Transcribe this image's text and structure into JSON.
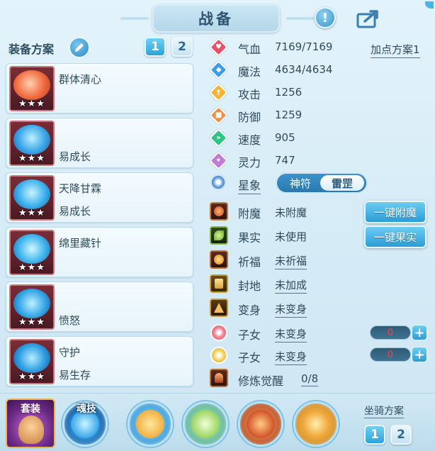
{
  "header": {
    "title": "战备",
    "info_icon": "exclamation-icon",
    "share_icon": "share-icon"
  },
  "equip_scheme": {
    "label": "装备方案",
    "edit_icon": "pencil-icon",
    "slots": [
      "1",
      "2"
    ],
    "selected_slot": "1"
  },
  "items": [
    {
      "name": "群体清心",
      "sub": "",
      "stars": "★★★",
      "icon": "scroll-icon"
    },
    {
      "name": "",
      "sub": "易成长",
      "stars": "★★★",
      "icon": "crown-icon"
    },
    {
      "name": "天降甘霖",
      "sub": "易成长",
      "stars": "★★★",
      "icon": "armor-icon"
    },
    {
      "name": "绵里藏针",
      "sub": "",
      "stars": "★★★",
      "icon": "necklace-icon"
    },
    {
      "name": "",
      "sub": "愤怒",
      "stars": "★★★",
      "icon": "belt-icon"
    },
    {
      "name": "守护",
      "sub": "易生存",
      "stars": "★★★",
      "icon": "boots-icon"
    }
  ],
  "stats": [
    {
      "name": "气血",
      "value": "7169/7169",
      "icon": "heart-icon",
      "color": "#e9506a"
    },
    {
      "name": "魔法",
      "value": "4634/4634",
      "icon": "mana-icon",
      "color": "#3a9fe6"
    },
    {
      "name": "攻击",
      "value": "1256",
      "icon": "sword-icon",
      "color": "#f2b632"
    },
    {
      "name": "防御",
      "value": "1259",
      "icon": "shield-icon",
      "color": "#f0904a"
    },
    {
      "name": "速度",
      "value": "905",
      "icon": "speed-icon",
      "color": "#2fc486"
    },
    {
      "name": "灵力",
      "value": "747",
      "icon": "spirit-icon",
      "color": "#c47ad8"
    }
  ],
  "add_point_plan": "加点方案1",
  "star_sign": {
    "label": "星象",
    "options": [
      "神符",
      "雷罡"
    ],
    "selected": "雷罡",
    "icon": "star-compass-icon"
  },
  "buffs": [
    {
      "name": "附魔",
      "value": "未附魔",
      "icon": "enchant-icon"
    },
    {
      "name": "果实",
      "value": "未使用",
      "icon": "fruit-icon"
    },
    {
      "name": "祈福",
      "value": "未祈福",
      "icon": "blessing-icon"
    },
    {
      "name": "封地",
      "value": "未加成",
      "icon": "fief-icon"
    },
    {
      "name": "变身",
      "value": "未变身",
      "icon": "transform-icon"
    }
  ],
  "children": [
    {
      "name": "子女",
      "value": "未变身",
      "count": "0",
      "icon": "child-icon-a"
    },
    {
      "name": "子女",
      "value": "未变身",
      "count": "0",
      "icon": "child-icon-b"
    }
  ],
  "cultivation": {
    "label": "修炼觉醒",
    "value": "0/8",
    "icon": "cultivation-icon"
  },
  "actions": {
    "enchant_all": "一键附魔",
    "fruit_all": "一键果实"
  },
  "bottom": {
    "suit_label": "套装",
    "soul_label": "魂技",
    "orbs": [
      "pet-skill-icon-1",
      "pet-skill-icon-2",
      "pet-skill-icon-3",
      "pet-skill-icon-4"
    ],
    "mount_label": "坐骑方案",
    "mount_slots": [
      "1",
      "2"
    ],
    "mount_selected": "1"
  }
}
